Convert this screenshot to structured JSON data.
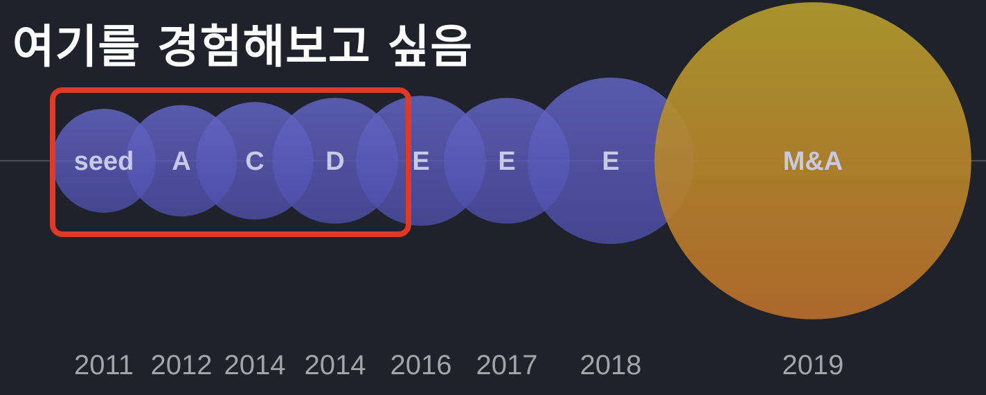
{
  "annotation": {
    "text": "여기를 경험해보고 싶음",
    "highlight_color": "#e03a26"
  },
  "chart_data": {
    "type": "scatter",
    "title": "",
    "xlabel": "",
    "ylabel": "",
    "grid": false,
    "legend": "none",
    "colors": {
      "funding_round": "#5a5cb8",
      "exit": "#c9922a"
    },
    "points": [
      {
        "year": "2011",
        "label": "seed",
        "kind": "funding_round",
        "size": 1.0
      },
      {
        "year": "2012",
        "label": "A",
        "kind": "funding_round",
        "size": 1.07
      },
      {
        "year": "2014",
        "label": "C",
        "kind": "funding_round",
        "size": 1.13
      },
      {
        "year": "2014",
        "label": "D",
        "kind": "funding_round",
        "size": 1.21
      },
      {
        "year": "2016",
        "label": "E",
        "kind": "funding_round",
        "size": 1.25
      },
      {
        "year": "2017",
        "label": "E",
        "kind": "funding_round",
        "size": 1.21
      },
      {
        "year": "2018",
        "label": "E",
        "kind": "funding_round",
        "size": 1.6
      },
      {
        "year": "2019",
        "label": "M&A",
        "kind": "exit",
        "size": 3.05
      }
    ],
    "highlighted_range": [
      "seed",
      "D"
    ]
  }
}
